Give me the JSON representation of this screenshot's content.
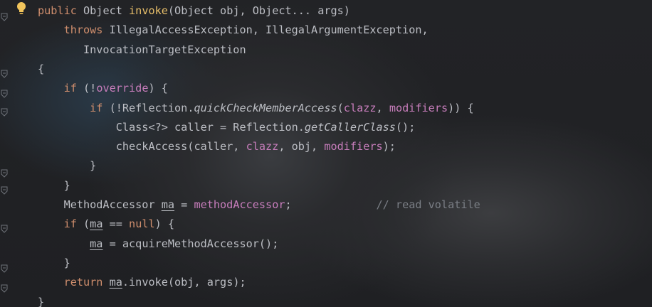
{
  "editor": {
    "language": "Java",
    "lines": [
      [
        {
          "t": "public ",
          "c": "kw"
        },
        {
          "t": "Object ",
          "c": ""
        },
        {
          "t": "invoke",
          "c": "fnc"
        },
        {
          "t": "(Object obj, Object... args)",
          "c": ""
        }
      ],
      [
        {
          "t": "    throws ",
          "c": "kw"
        },
        {
          "t": "IllegalAccessException, IllegalArgumentException,",
          "c": ""
        }
      ],
      [
        {
          "t": "       InvocationTargetException",
          "c": ""
        }
      ],
      [
        {
          "t": "{",
          "c": ""
        }
      ],
      [
        {
          "t": "    if ",
          "c": "kw"
        },
        {
          "t": "(!",
          "c": ""
        },
        {
          "t": "override",
          "c": "fld"
        },
        {
          "t": ") {",
          "c": ""
        }
      ],
      [
        {
          "t": "        if ",
          "c": "kw"
        },
        {
          "t": "(!Reflection.",
          "c": ""
        },
        {
          "t": "quickCheckMemberAccess",
          "c": "it"
        },
        {
          "t": "(",
          "c": ""
        },
        {
          "t": "clazz",
          "c": "fld"
        },
        {
          "t": ", ",
          "c": ""
        },
        {
          "t": "modifiers",
          "c": "fld"
        },
        {
          "t": ")) {",
          "c": ""
        }
      ],
      [
        {
          "t": "            Class<?> caller = Reflection.",
          "c": ""
        },
        {
          "t": "getCallerClass",
          "c": "it"
        },
        {
          "t": "();",
          "c": ""
        }
      ],
      [
        {
          "t": "            checkAccess(caller, ",
          "c": ""
        },
        {
          "t": "clazz",
          "c": "fld"
        },
        {
          "t": ", obj, ",
          "c": ""
        },
        {
          "t": "modifiers",
          "c": "fld"
        },
        {
          "t": ");",
          "c": ""
        }
      ],
      [
        {
          "t": "        }",
          "c": ""
        }
      ],
      [
        {
          "t": "    }",
          "c": ""
        }
      ],
      [
        {
          "t": "    MethodAccessor ",
          "c": ""
        },
        {
          "t": "ma",
          "c": "ul"
        },
        {
          "t": " = ",
          "c": ""
        },
        {
          "t": "methodAccessor",
          "c": "fld"
        },
        {
          "t": ";             ",
          "c": ""
        },
        {
          "t": "// read volatile",
          "c": "cm"
        }
      ],
      [
        {
          "t": "    if ",
          "c": "kw"
        },
        {
          "t": "(",
          "c": ""
        },
        {
          "t": "ma",
          "c": "ul"
        },
        {
          "t": " == ",
          "c": ""
        },
        {
          "t": "null",
          "c": "kw"
        },
        {
          "t": ") {",
          "c": ""
        }
      ],
      [
        {
          "t": "        ",
          "c": ""
        },
        {
          "t": "ma",
          "c": "ul"
        },
        {
          "t": " = acquireMethodAccessor();",
          "c": ""
        }
      ],
      [
        {
          "t": "    }",
          "c": ""
        }
      ],
      [
        {
          "t": "    return ",
          "c": "kw"
        },
        {
          "t": "ma",
          "c": "ul"
        },
        {
          "t": ".invoke(obj, args);",
          "c": ""
        }
      ],
      [
        {
          "t": "}",
          "c": ""
        }
      ]
    ]
  },
  "colors": {
    "keyword": "#cf8e6d",
    "method_decl": "#e8bf6a",
    "field": "#c77dbb",
    "comment": "#7a7e85",
    "text": "#bcbec4",
    "background": "#1e1f22"
  },
  "icons": {
    "intention": "lightbulb-icon",
    "fold": "fold-marker-icon"
  }
}
